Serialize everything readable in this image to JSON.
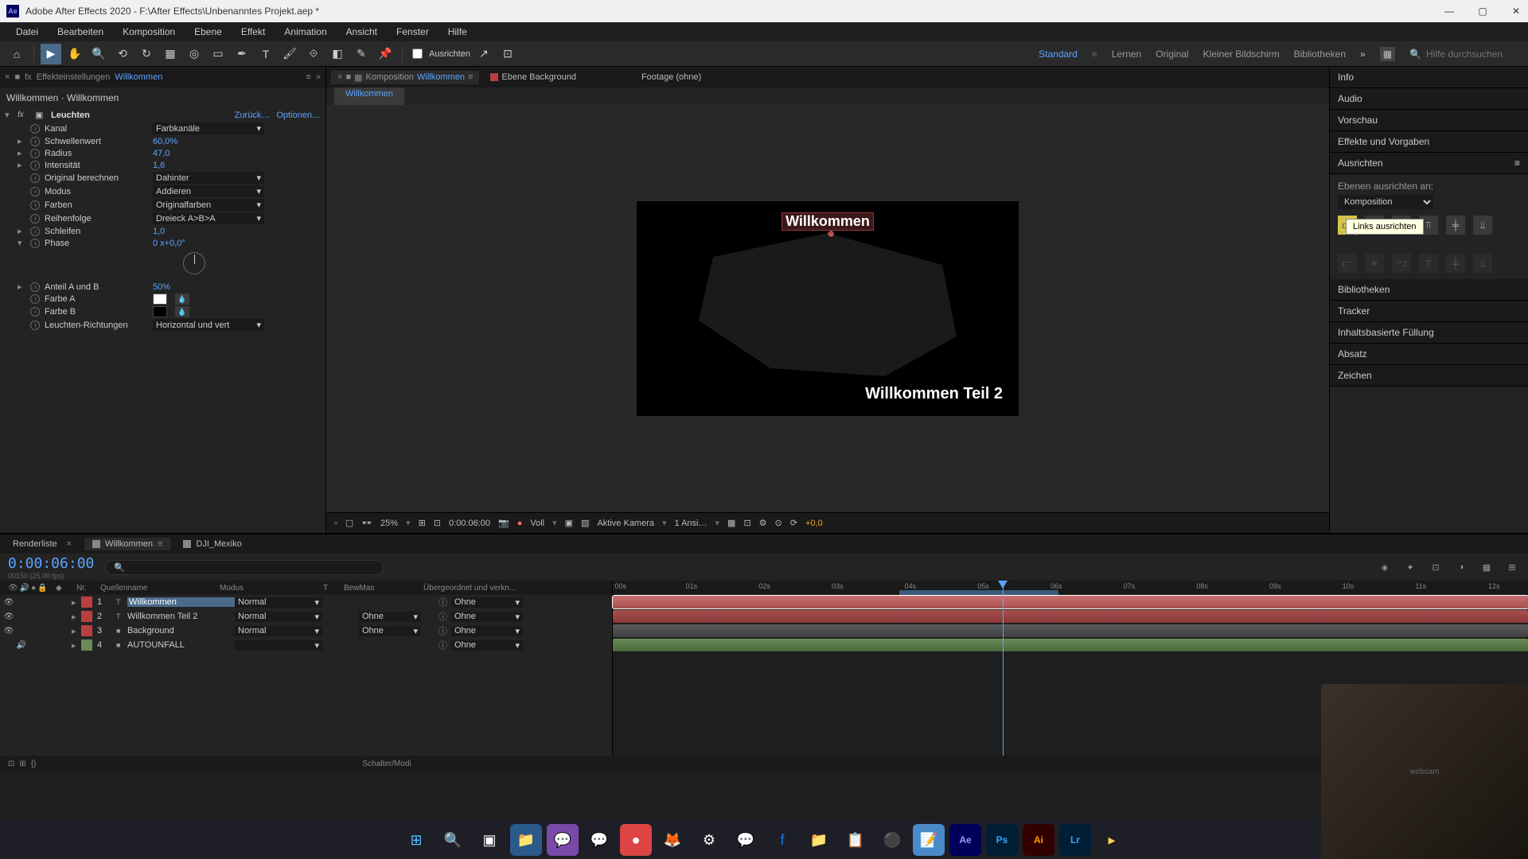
{
  "titlebar": {
    "app_icon_text": "Ae",
    "title": "Adobe After Effects 2020 - F:\\After Effects\\Unbenanntes Projekt.aep *"
  },
  "menubar": [
    "Datei",
    "Bearbeiten",
    "Komposition",
    "Ebene",
    "Effekt",
    "Animation",
    "Ansicht",
    "Fenster",
    "Hilfe"
  ],
  "toolbar": {
    "align_checkbox": "Ausrichten",
    "workspaces": [
      "Standard",
      "Lernen",
      "Original",
      "Kleiner Bildschirm",
      "Bibliotheken"
    ],
    "active_workspace": "Standard",
    "search_placeholder": "Hilfe durchsuchen"
  },
  "left_panel": {
    "tab_prefix": "Effekteinstellungen",
    "tab_link": "Willkommen",
    "comp_layer": "Willkommen · Willkommen",
    "effect_name": "Leuchten",
    "action_reset": "Zurück…",
    "action_options": "Optionen…",
    "props": {
      "kanal": {
        "name": "Kanal",
        "value": "Farbkanäle"
      },
      "schwellenwert": {
        "name": "Schwellenwert",
        "value": "60,0%"
      },
      "radius": {
        "name": "Radius",
        "value": "47,0"
      },
      "intensitaet": {
        "name": "Intensität",
        "value": "1,6"
      },
      "original": {
        "name": "Original berechnen",
        "value": "Dahinter"
      },
      "modus": {
        "name": "Modus",
        "value": "Addieren"
      },
      "farben": {
        "name": "Farben",
        "value": "Originalfarben"
      },
      "reihenfolge": {
        "name": "Reihenfolge",
        "value": "Dreieck A>B>A"
      },
      "schleifen": {
        "name": "Schleifen",
        "value": "1,0"
      },
      "phase": {
        "name": "Phase",
        "value": "0 x+0,0°"
      },
      "anteil": {
        "name": "Anteil A und B",
        "value": "50%"
      },
      "farbeA": {
        "name": "Farbe A",
        "color": "#ffffff"
      },
      "farbeB": {
        "name": "Farbe B",
        "color": "#000000"
      },
      "richtungen": {
        "name": "Leuchten-Richtungen",
        "value": "Horizontal und vert"
      }
    }
  },
  "center_panel": {
    "main_tab_prefix": "Komposition",
    "main_tab_link": "Willkommen",
    "layer_tab": "Ebene Background",
    "footage_tab": "Footage (ohne)",
    "flow_tab": "Willkommen",
    "text1": "Willkommen",
    "text2": "Willkommen Teil 2",
    "footer": {
      "zoom": "25%",
      "timecode": "0:00:06:00",
      "resolution": "Voll",
      "camera": "Aktive Kamera",
      "views": "1 Ansi…",
      "exposure": "+0,0"
    }
  },
  "right_panel": {
    "panels": {
      "info": "Info",
      "audio": "Audio",
      "vorschau": "Vorschau",
      "effekte": "Effekte und Vorgaben",
      "ausrichten": "Ausrichten",
      "bibliotheken": "Bibliotheken",
      "tracker": "Tracker",
      "inhalt": "Inhaltsbasierte Füllung",
      "absatz": "Absatz",
      "zeichen": "Zeichen"
    },
    "align_body": {
      "label": "Ebenen ausrichten an:",
      "dropdown": "Komposition",
      "tooltip": "Links ausrichten"
    }
  },
  "timeline": {
    "tabs": {
      "render": "Renderliste",
      "active": "Willkommen",
      "other": "DJI_Mexiko"
    },
    "timecode": "0:00:06:00",
    "sub_timecode": "00150 (25.00 fps)",
    "columns": {
      "num": "Nr.",
      "name": "Quellenname",
      "mode": "Modus",
      "t": "T",
      "bw": "BewMas",
      "parent": "Übergeordnet und verkn…"
    },
    "layers": [
      {
        "num": "1",
        "name": "Willkommen",
        "mode": "Normal",
        "bw": "",
        "parent": "Ohne",
        "type": "T",
        "color": "#b84040",
        "selected": true
      },
      {
        "num": "2",
        "name": "Willkommen Teil 2",
        "mode": "Normal",
        "bw": "Ohne",
        "parent": "Ohne",
        "type": "T",
        "color": "#b84040"
      },
      {
        "num": "3",
        "name": "Background",
        "mode": "Normal",
        "bw": "Ohne",
        "parent": "Ohne",
        "type": "",
        "color": "#b84040"
      },
      {
        "num": "4",
        "name": "AUTOUNFALL",
        "mode": "",
        "bw": "",
        "parent": "Ohne",
        "type": "",
        "color": "#6a8a5a"
      }
    ],
    "ruler": [
      ":00s",
      "01s",
      "02s",
      "03s",
      "04s",
      "05s",
      "06s",
      "07s",
      "08s",
      "09s",
      "10s",
      "11s",
      "12s"
    ],
    "footer_center": "Schalter/Modi"
  }
}
